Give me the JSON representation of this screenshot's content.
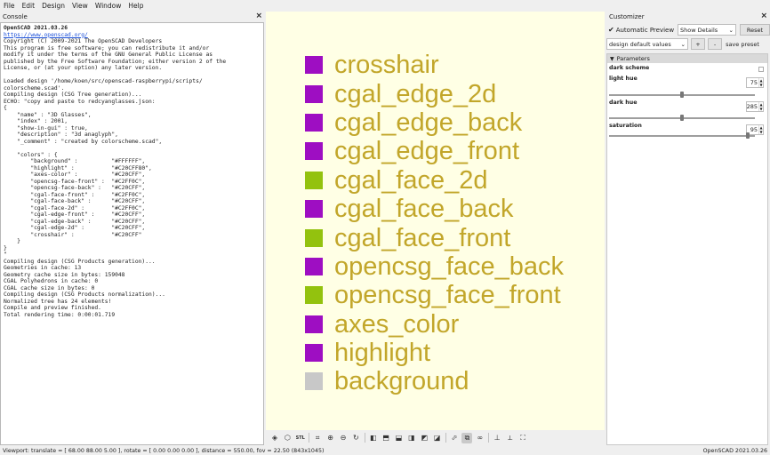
{
  "menu": [
    "File",
    "Edit",
    "Design",
    "View",
    "Window",
    "Help"
  ],
  "console": {
    "title": "Console",
    "version_line": "OpenSCAD 2021.03.26",
    "url": "https://www.openscad.org/",
    "text": "\nCopyright (C) 2009-2021 The OpenSCAD Developers\nThis program is free software; you can redistribute it and/or\nmodify it under the terms of the GNU General Public License as\npublished by the Free Software Foundation; either version 2 of the\nLicense, or (at your option) any later version.\n\nLoaded design '/home/koen/src/openscad-raspberrypi/scripts/\ncolorscheme.scad'.\nCompiling design (CSG Tree generation)...\nECHO: \"copy and paste to redcyanglasses.json:\n{\n    \"name\" : \"3D Glasses\",\n    \"index\" : 2001,\n    \"show-in-gui\" : true,\n    \"description\" : \"3d anaglyph\",\n    \"_comment\" : \"created by colorscheme.scad\",\n\n    \"colors\" : {\n        \"background\" :          \"#FFFFFF\",\n        \"highlight\" :           \"#C20CFF80\",\n        \"axes-color\" :          \"#C20CFF\",\n        \"opencsg-face-front\" :  \"#C2FF0C\",\n        \"opencsg-face-back\" :   \"#C20CFF\",\n        \"cgal-face-front\" :     \"#C2FF0C\",\n        \"cgal-face-back\" :      \"#C20CFF\",\n        \"cgal-face-2d\" :        \"#C2FF0C\",\n        \"cgal-edge-front\" :     \"#C20CFF\",\n        \"cgal-edge-back\" :      \"#C20CFF\",\n        \"cgal-edge-2d\" :        \"#C20CFF\",\n        \"crosshair\" :           \"#C20CFF\"\n    }\n}\n\"\nCompiling design (CSG Products generation)...\nGeometries in cache: 13\nGeometry cache size in bytes: 159048\nCGAL Polyhedrons in cache: 0\nCGAL cache size in bytes: 0\nCompiling design (CSG Products normalization)...\nNormalized tree has 24 elements!\nCompile and preview finished.\nTotal rendering time: 0:00:01.719"
  },
  "viewport": {
    "legend": [
      {
        "label": "crosshair",
        "color": "#9e0ec2"
      },
      {
        "label": "cgal_edge_2d",
        "color": "#9e0ec2"
      },
      {
        "label": "cgal_edge_back",
        "color": "#9e0ec2"
      },
      {
        "label": "cgal_edge_front",
        "color": "#9e0ec2"
      },
      {
        "label": "cgal_face_2d",
        "color": "#93c20e"
      },
      {
        "label": "cgal_face_back",
        "color": "#9e0ec2"
      },
      {
        "label": "cgal_face_front",
        "color": "#93c20e"
      },
      {
        "label": "opencsg_face_back",
        "color": "#9e0ec2"
      },
      {
        "label": "opencsg_face_front",
        "color": "#93c20e"
      },
      {
        "label": "axes_color",
        "color": "#9e0ec2"
      },
      {
        "label": "highlight",
        "color": "#9e0ec2"
      },
      {
        "label": "background",
        "color": "#c8c8c8"
      }
    ],
    "text_color": "#c2a62a",
    "background_color": "#ffffe5"
  },
  "toolbar": {
    "icons": [
      "preview-icon",
      "render-icon",
      "stl-export-icon",
      "zoom-all-icon",
      "zoom-in-icon",
      "zoom-out-icon",
      "reset-view-icon",
      "view-right-icon",
      "view-top-icon",
      "view-bottom-icon",
      "view-left-icon",
      "view-front-icon",
      "view-back-icon",
      "perspective-icon",
      "orthogonal-icon",
      "anaglyph-icon",
      "show-axes-icon",
      "show-scale-icon",
      "show-edges-icon"
    ]
  },
  "customizer": {
    "title": "Customizer",
    "automatic_preview": "Automatic Preview",
    "automatic_preview_checked": true,
    "details_select": "Show Details",
    "reset_label": "Reset",
    "preset_select": "design default values",
    "add_label": "+",
    "remove_label": "-",
    "save_preset_label": "save preset",
    "group_label": "Parameters",
    "params": [
      {
        "name": "dark scheme",
        "type": "checkbox",
        "checked": false
      },
      {
        "name": "light hue",
        "type": "slider",
        "value": "75",
        "fraction": 0.5
      },
      {
        "name": "dark hue",
        "type": "slider",
        "value": "285",
        "fraction": 0.5
      },
      {
        "name": "saturation",
        "type": "slider",
        "value": "95",
        "fraction": 0.95
      }
    ]
  },
  "status": {
    "viewport_info": "Viewport: translate = [ 68.00 88.00 5.00 ], rotate = [ 0.00 0.00 0.00 ], distance = 550.00, fov = 22.50 (843x1045)",
    "version": "OpenSCAD 2021.03.26"
  }
}
